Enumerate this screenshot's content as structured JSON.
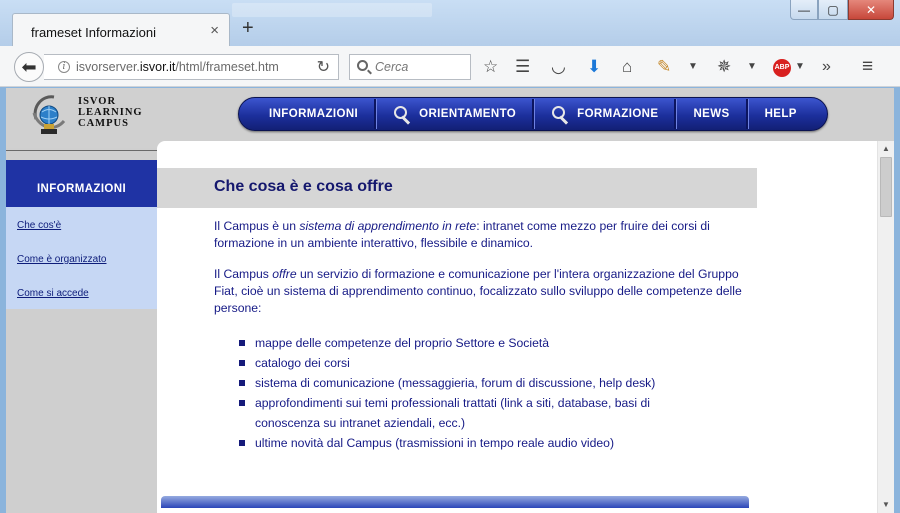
{
  "browser": {
    "tab_title": "frameset Informazioni",
    "tab_close": "×",
    "new_tab": "+",
    "url_host": "isvorserver.",
    "url_domain": "isvor.it",
    "url_path": "/html/frameset.htm",
    "search_placeholder": "Cerca",
    "window_buttons": {
      "minimize": "—",
      "maximize": "▢",
      "close": "✕"
    }
  },
  "site": {
    "logo_lines": [
      "ISVOR",
      "LEARNING",
      "CAMPUS"
    ],
    "menu": [
      "INFORMAZIONI",
      "ORIENTAMENTO",
      "FORMAZIONE",
      "NEWS",
      "HELP"
    ]
  },
  "sidebar": {
    "heading": "INFORMAZIONI",
    "links": [
      "Che cos'è",
      "Come è organizzato",
      "Come si accede"
    ]
  },
  "main": {
    "title": "Che cosa è e cosa offre",
    "p1_a": "Il Campus è un ",
    "p1_em": "sistema di apprendimento in rete",
    "p1_b": ": intranet come mezzo per fruire dei corsi di formazione in un ambiente interattivo, flessibile e dinamico.",
    "p2_a": "Il Campus ",
    "p2_em": "offre",
    "p2_b": " un servizio di formazione e comunicazione per l'intera organizzazione del Gruppo Fiat, cioè un sistema di apprendimento continuo, focalizzato sullo sviluppo delle competenze delle persone:",
    "bullets": [
      "mappe delle competenze del proprio Settore e Società",
      "catalogo dei corsi",
      "sistema di comunicazione (messaggieria, forum di discussione, help desk)",
      "approfondimenti sui temi professionali trattati (link a siti, database, basi di conoscenza su intranet aziendali, ecc.)",
      "ultime novità dal Campus (trasmissioni in tempo reale audio video)"
    ]
  },
  "colors": {
    "menu_blue": "#1c2f9c",
    "text_navy": "#161a86",
    "sidebar_head": "#1f33a4",
    "sidebar_links_bg": "#c6d7f4"
  }
}
